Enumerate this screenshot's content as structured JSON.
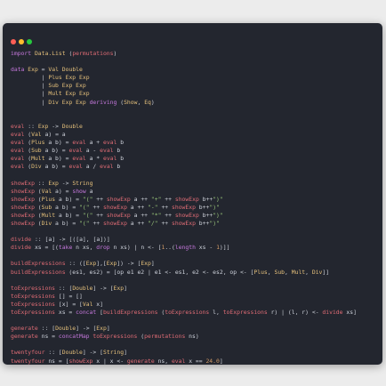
{
  "window": {
    "traffic_lights": [
      {
        "name": "close",
        "color": "#ff5f56"
      },
      {
        "name": "minimize",
        "color": "#ffbd2e"
      },
      {
        "name": "maximize",
        "color": "#27c93f"
      }
    ]
  },
  "colors": {
    "background": "#23262f",
    "text": "#cfd3dc",
    "keyword": "#c678dd",
    "type": "#e5c07b",
    "function": "#e06c75",
    "string": "#98c379"
  },
  "code_lines": [
    "import Data.List (permutations)",
    "",
    "data Exp = Val Double",
    "         | Plus Exp Exp",
    "         | Sub Exp Exp",
    "         | Mult Exp Exp",
    "         | Div Exp Exp deriving (Show, Eq)",
    "",
    "",
    "eval :: Exp -> Double",
    "eval (Val a) = a",
    "eval (Plus a b) = eval a + eval b",
    "eval (Sub a b) = eval a - eval b",
    "eval (Mult a b) = eval a * eval b",
    "eval (Div a b) = eval a / eval b",
    "",
    "showExp :: Exp -> String",
    "showExp (Val a) = show a",
    "showExp (Plus a b) = \"(\" ++ showExp a ++ \"+\" ++ showExp b++\")\"",
    "showExp (Sub a b) = \"(\" ++ showExp a ++ \"-\" ++ showExp b++\")\"",
    "showExp (Mult a b) = \"(\" ++ showExp a ++ \"*\" ++ showExp b++\")\"",
    "showExp (Div a b) = \"(\" ++ showExp a ++ \"/\" ++ showExp b++\")\"",
    "",
    "divide :: [a] -> [([a], [a])]",
    "divide xs = [(take n xs, drop n xs) | n <- [1..(length xs - 1)]]",
    "",
    "buildExpressions :: ([Exp],[Exp]) -> [Exp]",
    "buildExpressions (es1, es2) = [op e1 e2 | e1 <- es1, e2 <- es2, op <- [Plus, Sub, Mult, Div]]",
    "",
    "toExpressions :: [Double] -> [Exp]",
    "toExpressions [] = []",
    "toExpressions [x] = [Val x]",
    "toExpressions xs = concat [buildExpressions (toExpressions l, toExpressions r) | (l, r) <- divide xs]",
    "",
    "generate :: [Double] -> [Exp]",
    "generate ns = concatMap toExpressions (permutations ns)",
    "",
    "twentyfour :: [Double] -> [String]",
    "twentyfour ns = [showExp x | x <- generate ns, eval x == 24.0]"
  ]
}
